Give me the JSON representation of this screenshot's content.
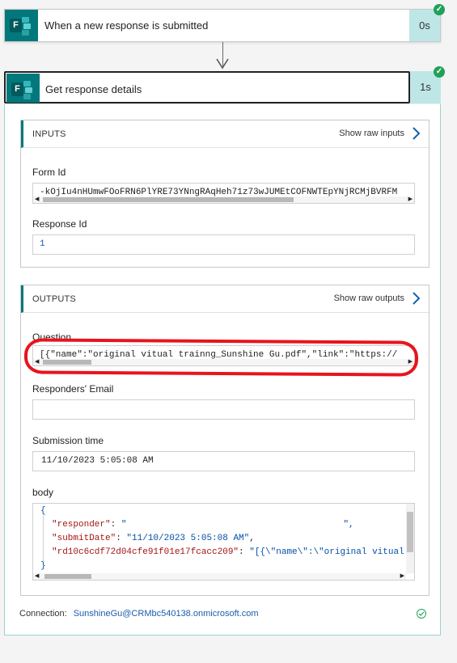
{
  "trigger": {
    "title": "When a new response is submitted",
    "duration": "0s",
    "status": "succeeded"
  },
  "action": {
    "title": "Get response details",
    "duration": "1s",
    "status": "succeeded"
  },
  "inputs": {
    "header": "INPUTS",
    "show_raw": "Show raw inputs",
    "form_id_label": "Form Id",
    "form_id_value": "-kOjIu4nHUmwFOoFRN6PlYRE73YNngRAqHeh71z73wJUMEtCOFNWTEpYNjRCMjBVRFM",
    "response_id_label": "Response Id",
    "response_id_value": "1"
  },
  "outputs": {
    "header": "OUTPUTS",
    "show_raw": "Show raw outputs",
    "question_label": "Question",
    "question_value": "[{\"name\":\"original vitual trainng_Sunshine Gu.pdf\",\"link\":\"https://",
    "responders_email_label": "Responders' Email",
    "responders_email_value": "",
    "submission_time_label": "Submission time",
    "submission_time_value": "11/10/2023 5:05:08 AM",
    "body_label": "body",
    "body_lines": {
      "open": "{",
      "responder_key": "\"responder\"",
      "responder_sep": ": ",
      "responder_val": "\"",
      "responder_end": "\",",
      "submit_key": "\"submitDate\"",
      "submit_sep": ": ",
      "submit_val": "\"11/10/2023 5:05:08 AM\"",
      "submit_end": ",",
      "rd_key": "\"rd10c6cdf72d04cfe91f01e17fcacc209\"",
      "rd_sep": ": ",
      "rd_val": "\"[{\\\"name\\\":\\\"original vitual",
      "close": "}"
    }
  },
  "connection": {
    "label": "Connection:",
    "account": "SunshineGu@CRMbc540138.onmicrosoft.com"
  },
  "colors": {
    "teal_brand": "#03787c",
    "duration_bg": "#bfe6e7",
    "success_green": "#22a05a",
    "annotation_red": "#e8141c",
    "link_blue": "#1a5ea8"
  }
}
